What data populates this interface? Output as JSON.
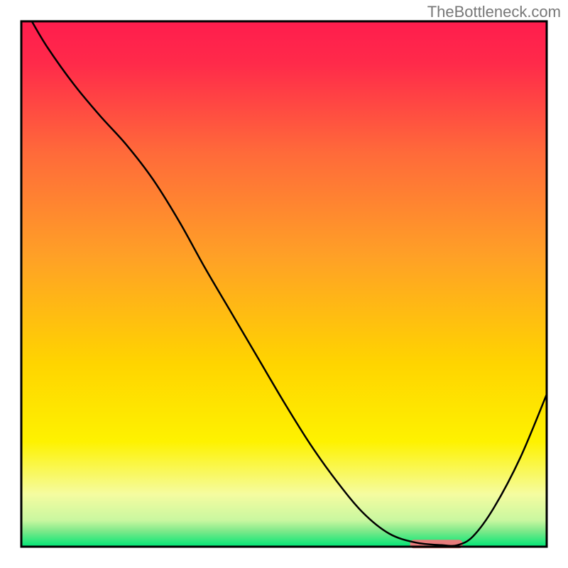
{
  "watermark": "TheBottleneck.com",
  "chart_data": {
    "type": "line",
    "title": "",
    "xlabel": "",
    "ylabel": "",
    "xlim": [
      0,
      100
    ],
    "ylim": [
      0,
      100
    ],
    "background_gradient": {
      "top_color": "#ff1d4d",
      "mid_color": "#ffd400",
      "bottom_color": "#00e676"
    },
    "border_color": "#000000",
    "curve_color": "#000000",
    "curve_points": [
      {
        "x": 2.0,
        "y": 100.0
      },
      {
        "x": 5.0,
        "y": 95.0
      },
      {
        "x": 10.0,
        "y": 88.0
      },
      {
        "x": 15.0,
        "y": 82.0
      },
      {
        "x": 20.0,
        "y": 76.5
      },
      {
        "x": 25.0,
        "y": 70.0
      },
      {
        "x": 30.0,
        "y": 62.0
      },
      {
        "x": 35.0,
        "y": 53.0
      },
      {
        "x": 40.0,
        "y": 44.5
      },
      {
        "x": 45.0,
        "y": 36.0
      },
      {
        "x": 50.0,
        "y": 27.5
      },
      {
        "x": 55.0,
        "y": 19.5
      },
      {
        "x": 60.0,
        "y": 12.5
      },
      {
        "x": 65.0,
        "y": 6.5
      },
      {
        "x": 70.0,
        "y": 2.5
      },
      {
        "x": 75.0,
        "y": 0.8
      },
      {
        "x": 80.0,
        "y": 0.3
      },
      {
        "x": 83.0,
        "y": 0.3
      },
      {
        "x": 86.0,
        "y": 2.0
      },
      {
        "x": 90.0,
        "y": 7.5
      },
      {
        "x": 95.0,
        "y": 17.0
      },
      {
        "x": 100.0,
        "y": 29.0
      }
    ],
    "highlight_bar": {
      "x_start": 74.0,
      "x_end": 84.0,
      "y": 0.5,
      "color": "#e77b7b"
    }
  }
}
